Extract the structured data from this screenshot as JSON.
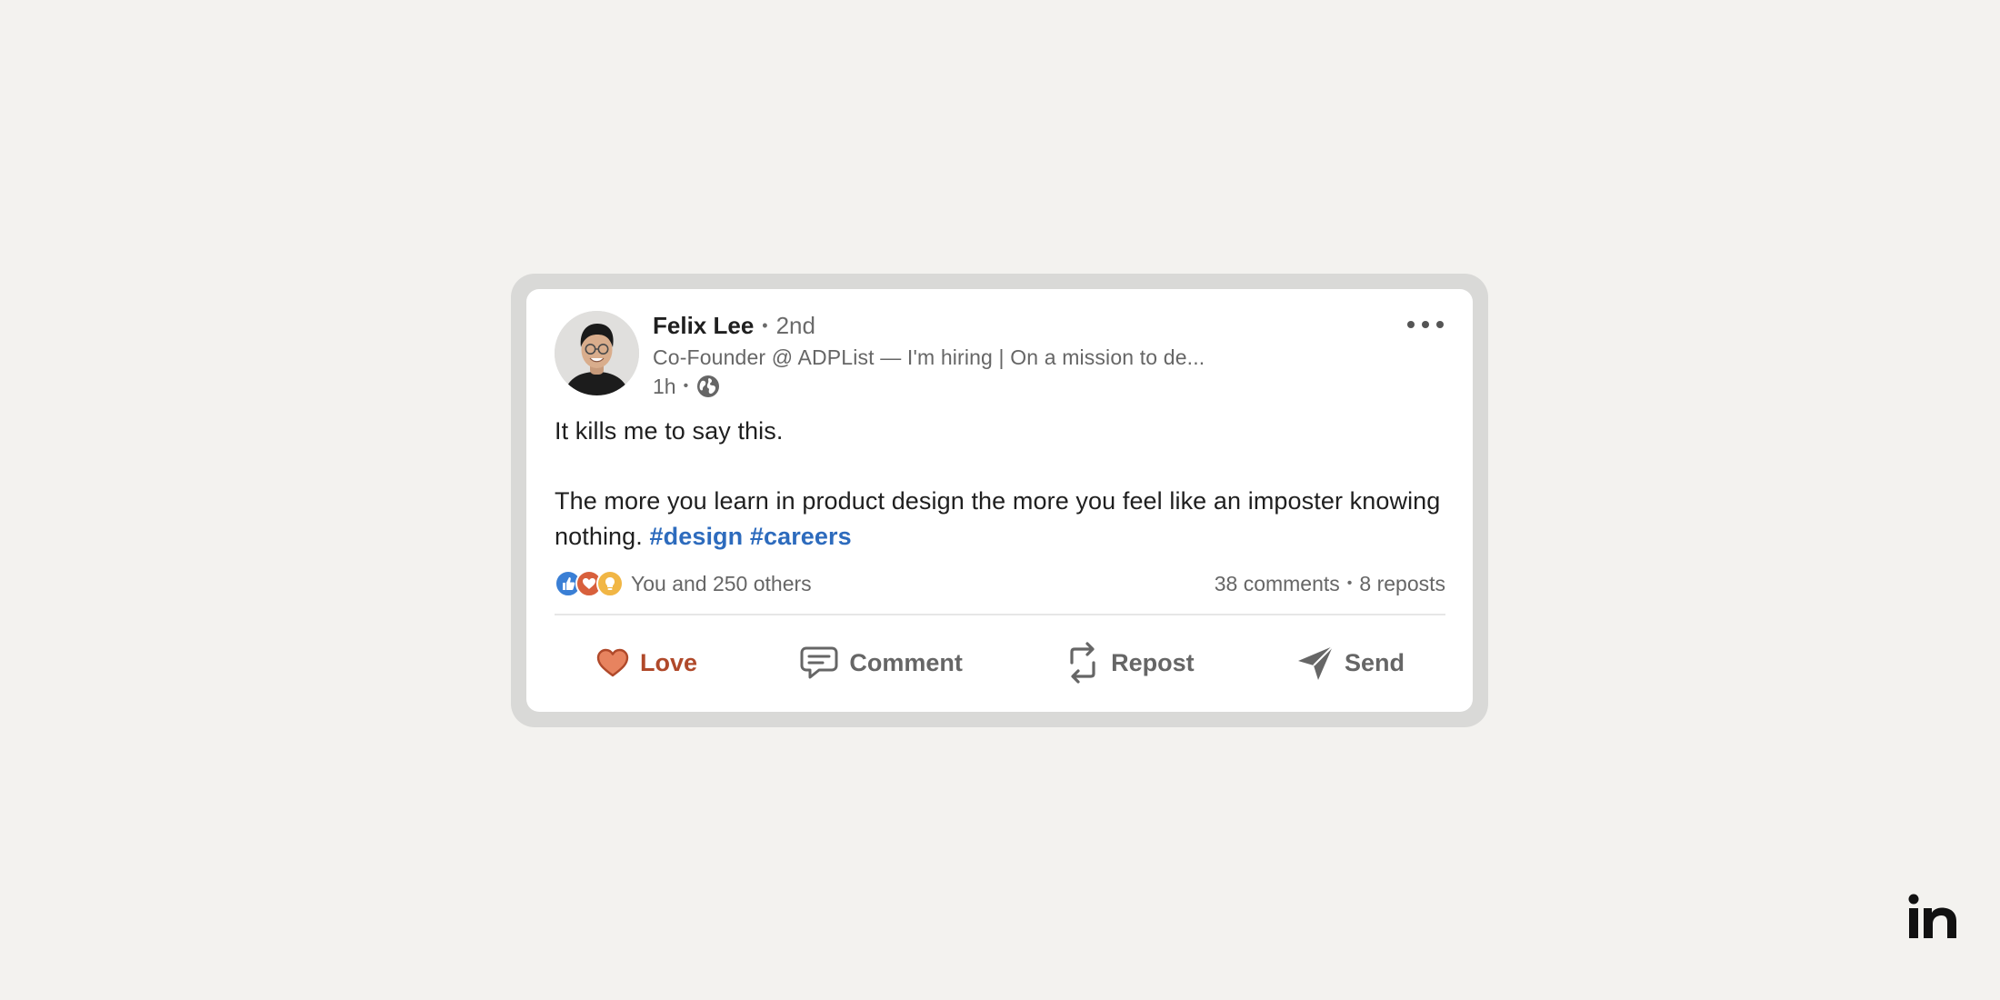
{
  "post": {
    "author": {
      "name": "Felix Lee",
      "separator": "•",
      "degree": "2nd",
      "headline": "Co-Founder @ ADPList — I'm hiring | On a mission to de...",
      "time": "1h",
      "visibility_icon": "globe-icon"
    },
    "more_icon": "more-horizontal-icon",
    "text": {
      "line1": "It kills me to say this.",
      "line2": "The more you learn in product design the more you feel like an imposter knowing nothing.",
      "hashtags": [
        "#design",
        "#careers"
      ]
    },
    "reactions": {
      "icons": [
        "like-icon",
        "love-icon",
        "insightful-icon"
      ],
      "summary": "You and 250 others"
    },
    "counts": {
      "comments": "38 comments",
      "separator": "•",
      "reposts": "8 reposts"
    },
    "actions": {
      "love": "Love",
      "comment": "Comment",
      "repost": "Repost",
      "send": "Send"
    }
  },
  "brand": {
    "logo_text": "in"
  },
  "colors": {
    "background": "#f3f2ef",
    "frame": "#d9d9d7",
    "card": "#ffffff",
    "hashtag": "#2d6bbd",
    "love": "#b0492a",
    "love_fill": "#e7835f",
    "muted_text": "#666666"
  }
}
